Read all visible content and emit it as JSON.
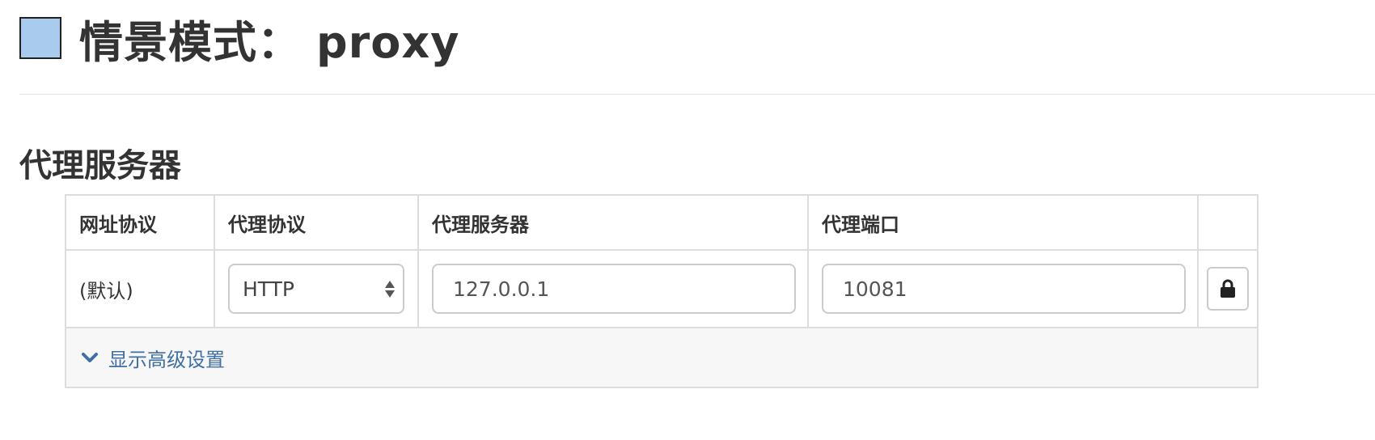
{
  "header": {
    "title_prefix": "情景模式：",
    "profile_name": "proxy",
    "profile_color": "#a8cbee"
  },
  "section": {
    "heading": "代理服务器"
  },
  "table": {
    "columns": [
      "网址协议",
      "代理协议",
      "代理服务器",
      "代理端口",
      ""
    ],
    "rows": [
      {
        "scheme": "(默认)",
        "protocol": "HTTP",
        "server": "127.0.0.1",
        "port": "10081",
        "lock_icon": "lock-icon"
      }
    ]
  },
  "advanced": {
    "label": "显示高级设置",
    "icon": "chevron-down-icon",
    "link_color": "#3f6fa3"
  }
}
